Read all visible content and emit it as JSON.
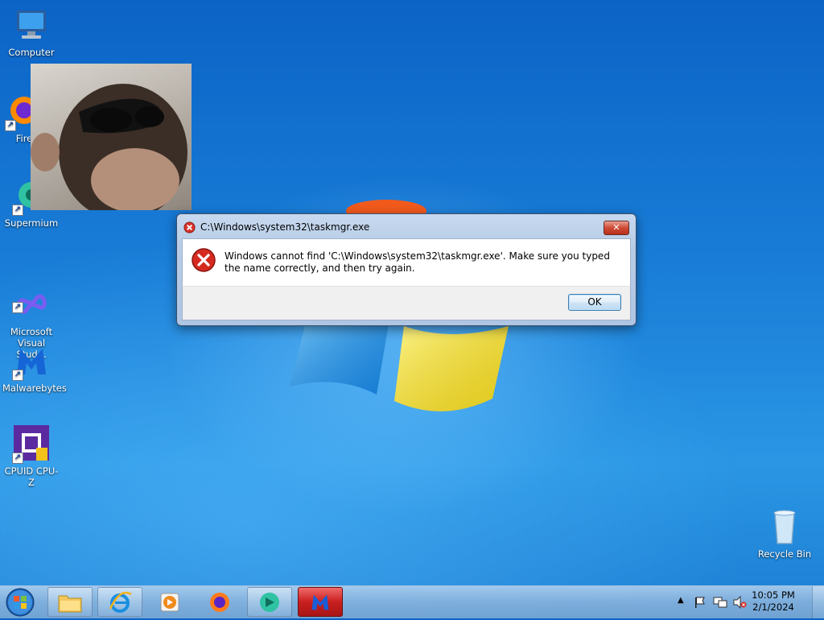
{
  "desktop": {
    "icons": [
      {
        "label": "Computer"
      },
      {
        "label": "Fire"
      },
      {
        "label": "Supermium"
      },
      {
        "label": "Microsoft\nVisual Stud..."
      },
      {
        "label": "Malwarebytes"
      },
      {
        "label": "CPUID CPU-Z"
      },
      {
        "label": "Recycle Bin"
      }
    ]
  },
  "dialog": {
    "title": "C:\\Windows\\system32\\taskmgr.exe",
    "message": "Windows cannot find 'C:\\Windows\\system32\\taskmgr.exe'. Make sure you typed the name correctly, and then try again.",
    "ok_label": "OK",
    "close_label": "✕"
  },
  "taskbar": {
    "items": [
      "start-orb",
      "file-explorer",
      "internet-explorer",
      "media-player",
      "firefox",
      "supermium",
      "malwarebytes"
    ],
    "clock": {
      "time": "10:05 PM",
      "date": "2/1/2024"
    }
  }
}
